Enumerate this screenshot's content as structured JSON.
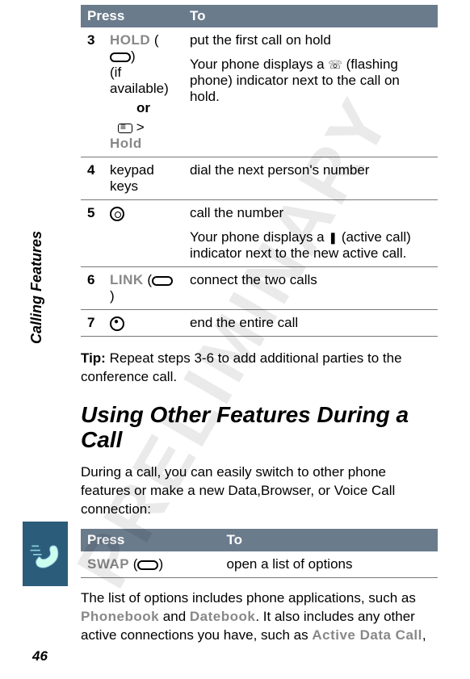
{
  "watermark": "PRELIMINARY",
  "side_label": "Calling Features",
  "page_number": "46",
  "table1": {
    "header_press": "Press",
    "header_to": "To",
    "rows": [
      {
        "step": "3",
        "press_main": "HOLD",
        "press_paren_open": "(",
        "press_paren_close": ")",
        "press_note": "(if available)",
        "press_or": "or",
        "press_alt_gt": " > ",
        "press_alt_label": "Hold",
        "to_line1": "put the first call on hold",
        "to_line2": "Your phone displays a ",
        "to_line2_icon": "☏",
        "to_line2b": " (flashing phone) indicator next to the call on hold."
      },
      {
        "step": "4",
        "press": "keypad keys",
        "to": "dial the next person's number"
      },
      {
        "step": "5",
        "to_line1": "call the number",
        "to_line2a": "Your phone displays a ",
        "to_line2_icon": "❚",
        "to_line2b": " (active call) indicator next to the new active call."
      },
      {
        "step": "6",
        "press_main": "LINK",
        "to": "connect the two calls"
      },
      {
        "step": "7",
        "to": "end the entire call"
      }
    ]
  },
  "tip_bold": "Tip:",
  "tip_text": " Repeat steps 3-6 to add additional parties to the conference call.",
  "section_title": "Using Other Features During a Call",
  "intro_para": "During a call, you can easily switch to other phone features or make a new Data,Browser, or Voice Call connection:",
  "table2": {
    "header_press": "Press",
    "header_to": "To",
    "row_press": "SWAP",
    "row_to": "open a list of options"
  },
  "closing_a": "The list of options includes phone applications, such as ",
  "closing_phonebook": "Phonebook",
  "closing_and": " and ",
  "closing_datebook": "Datebook",
  "closing_b": ". It also includes any other active connections you have, such as ",
  "closing_active": "Active Data Call",
  "closing_comma": ","
}
